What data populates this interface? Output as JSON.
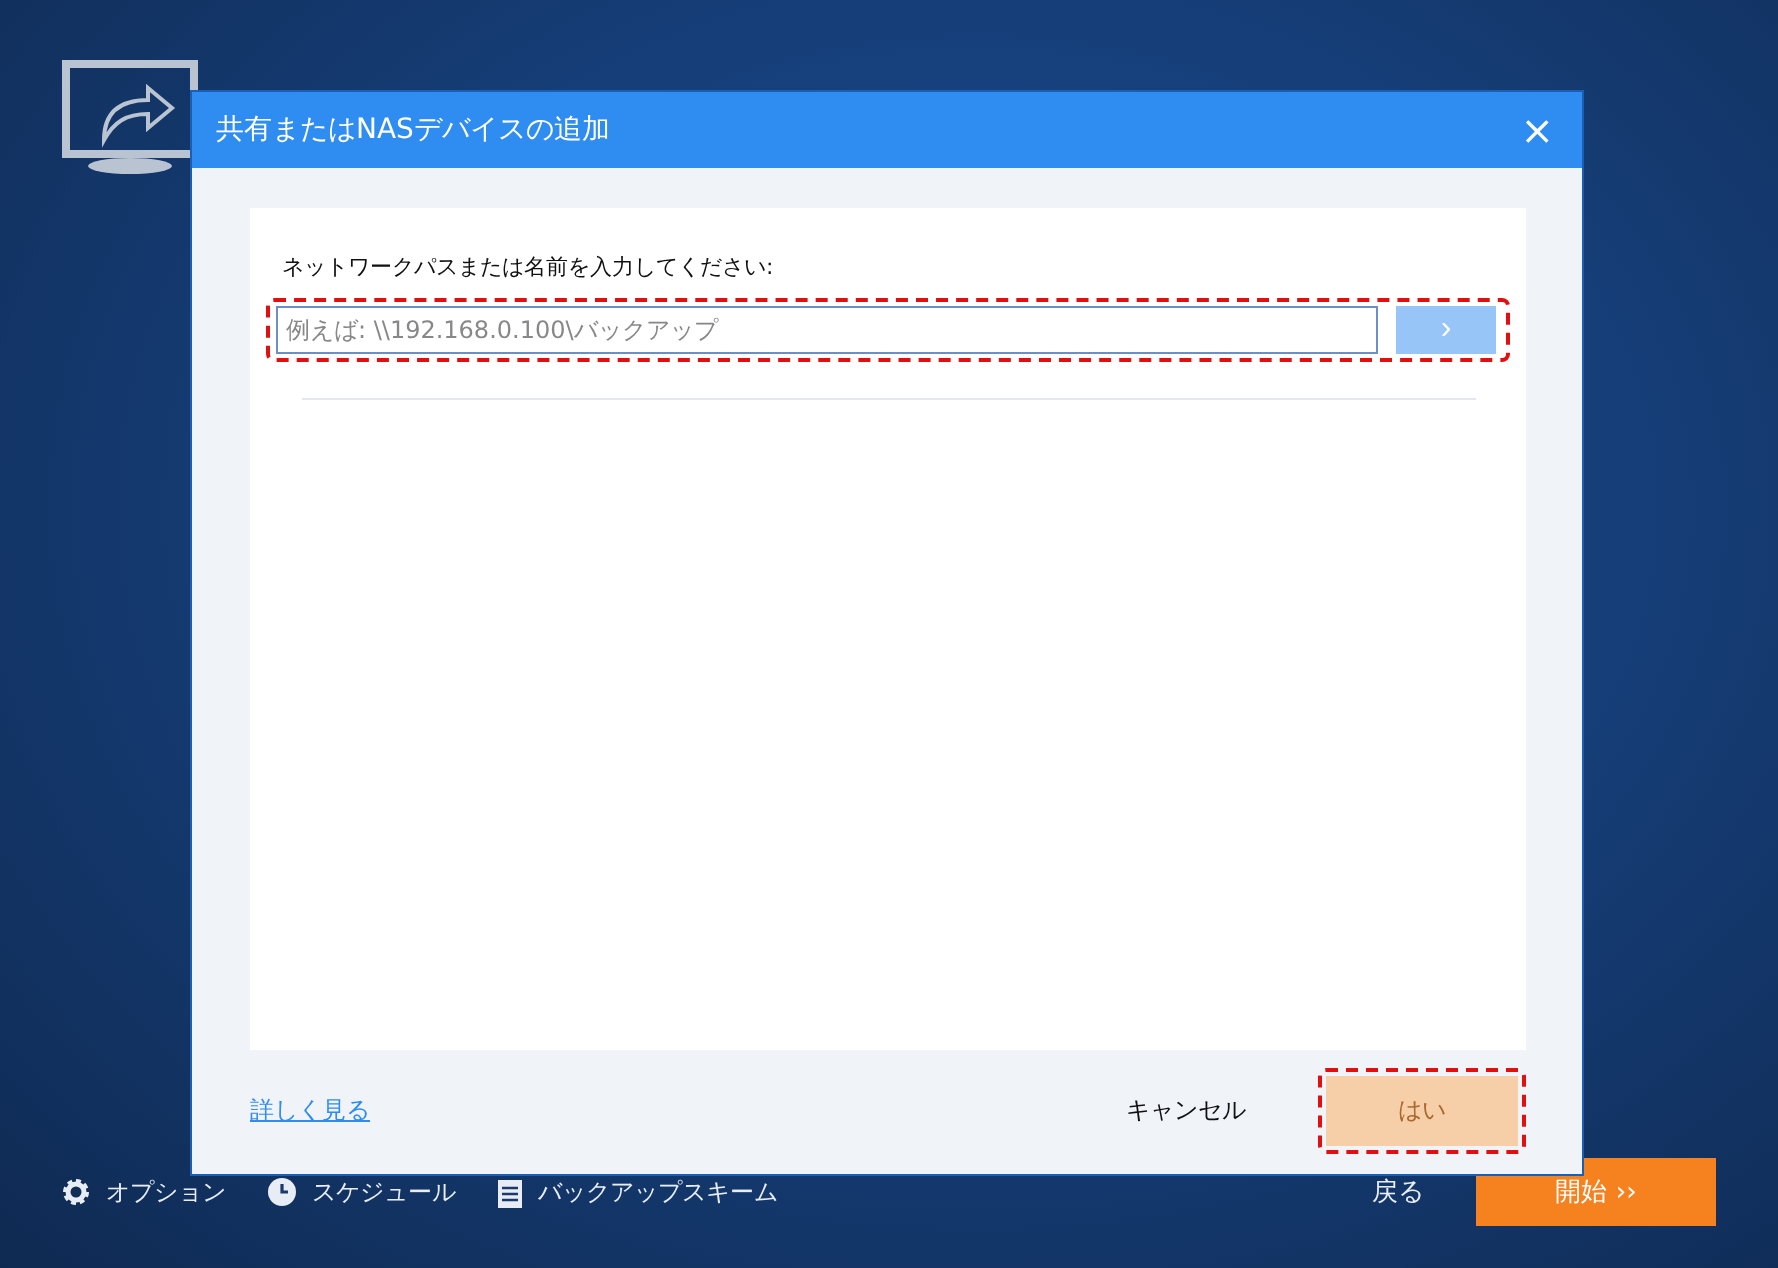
{
  "toolbar": [
    {
      "kind": "gear",
      "label": "オプション"
    },
    {
      "kind": "clock",
      "label": "スケジュール"
    },
    {
      "kind": "list",
      "label": "バックアップスキーム"
    }
  ],
  "back": "戻る",
  "start": "開始 ››",
  "dialog": {
    "title": "共有またはNASデバイスの追加",
    "close": "×",
    "prompt": "ネットワークパスまたは名前を入力してください:",
    "path_field": {
      "placeholder": "例えば: \\\\192.168.0.100\\バックアップ",
      "highlighted": true
    },
    "go_button": {
      "label": "›",
      "disabled": true
    },
    "link": "詳しく見る",
    "buttons": [
      {
        "label": "キャンセル",
        "kind": "plain",
        "disabled": false,
        "highlighted": false
      },
      {
        "label": "はい",
        "kind": "primary",
        "disabled": true,
        "highlighted": true
      }
    ]
  }
}
